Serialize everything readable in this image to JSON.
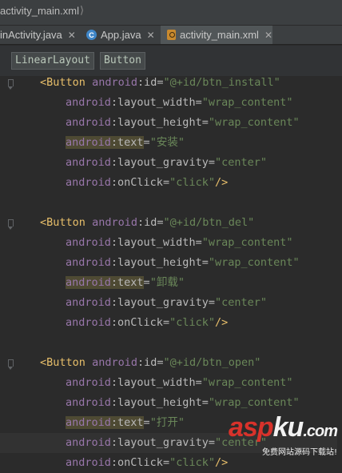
{
  "breadcrumb": {
    "text": "activity_main.xml"
  },
  "tabs": [
    {
      "label": "inActivity.java",
      "icon": "none"
    },
    {
      "label": "App.java",
      "icon": "java-class-icon"
    },
    {
      "label": "activity_main.xml",
      "icon": "xml-file-icon"
    }
  ],
  "structure_bar": {
    "items": [
      "LinearLayout",
      "Button"
    ]
  },
  "code": {
    "lines": [
      {
        "kind": "open",
        "tag": "Button",
        "attr": "id",
        "value": "@+id/btn_install"
      },
      {
        "kind": "attr",
        "attr": "layout_width",
        "value": "wrap_content"
      },
      {
        "kind": "attr",
        "attr": "layout_height",
        "value": "wrap_content"
      },
      {
        "kind": "attr",
        "attr": "text",
        "value": "安装",
        "highlight": true
      },
      {
        "kind": "attr",
        "attr": "layout_gravity",
        "value": "center"
      },
      {
        "kind": "close",
        "attr": "onClick",
        "value": "click"
      },
      {
        "kind": "blank"
      },
      {
        "kind": "open",
        "tag": "Button",
        "attr": "id",
        "value": "@+id/btn_del"
      },
      {
        "kind": "attr",
        "attr": "layout_width",
        "value": "wrap_content"
      },
      {
        "kind": "attr",
        "attr": "layout_height",
        "value": "wrap_content"
      },
      {
        "kind": "attr",
        "attr": "text",
        "value": "卸载",
        "highlight": true
      },
      {
        "kind": "attr",
        "attr": "layout_gravity",
        "value": "center"
      },
      {
        "kind": "close",
        "attr": "onClick",
        "value": "click"
      },
      {
        "kind": "blank"
      },
      {
        "kind": "open",
        "tag": "Button",
        "attr": "id",
        "value": "@+id/btn_open"
      },
      {
        "kind": "attr",
        "attr": "layout_width",
        "value": "wrap_content"
      },
      {
        "kind": "attr",
        "attr": "layout_height",
        "value": "wrap_content"
      },
      {
        "kind": "attr",
        "attr": "text",
        "value": "打开",
        "highlight": true
      },
      {
        "kind": "attr",
        "attr": "layout_gravity",
        "value": "center",
        "current": true
      },
      {
        "kind": "close",
        "attr": "onClick",
        "value": "click"
      }
    ],
    "namespace": "android"
  },
  "watermark": {
    "brand_a": "asp",
    "brand_b": "ku",
    "brand_c": ".com",
    "subtitle": "免费网站源码下载站!"
  },
  "colors": {
    "background": "#2b2b2b",
    "tag": "#e8bf6a",
    "attribute": "#9876aa",
    "string": "#6a8759",
    "highlight": "#4e4a33"
  }
}
